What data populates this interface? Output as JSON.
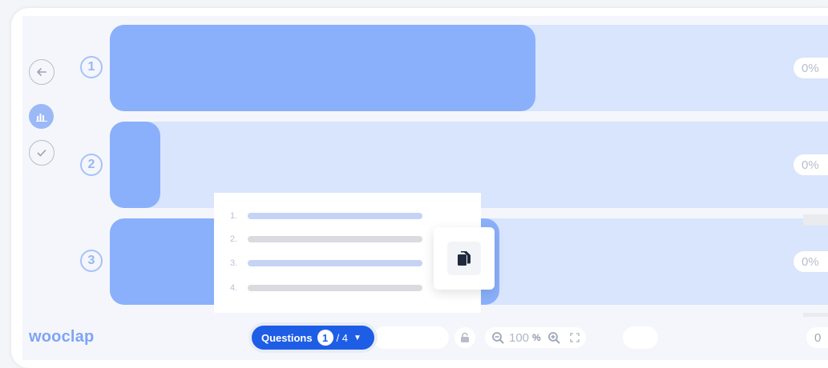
{
  "brand": {
    "logo_text": "wooclap"
  },
  "navigation": {
    "back_icon": "arrow-left-icon",
    "chart_icon": "bar-chart-icon",
    "check_icon": "check-icon"
  },
  "results": [
    {
      "number": "1",
      "percent": "0%",
      "fill_fraction": 0.59
    },
    {
      "number": "2",
      "percent": "0%",
      "fill_fraction": 0.07
    },
    {
      "number": "3",
      "percent": "0%",
      "fill_fraction": 0.54
    }
  ],
  "question_list": {
    "items": [
      {
        "number": "1.",
        "active": true
      },
      {
        "number": "2.",
        "active": false
      },
      {
        "number": "3.",
        "active": true
      },
      {
        "number": "4.",
        "active": false
      }
    ]
  },
  "copy_card": {
    "icon": "copy-icon"
  },
  "toolbar": {
    "questions_label": "Questions",
    "current_question": "1",
    "total_questions": "/ 4",
    "zoom_value": "100",
    "zoom_unit": "%",
    "participant_count": "0"
  },
  "colors": {
    "accent": "#1e5de6",
    "bar_fill": "#8ab0fb",
    "bar_track": "#d9e4fd",
    "logo": "#7fa4f5"
  }
}
